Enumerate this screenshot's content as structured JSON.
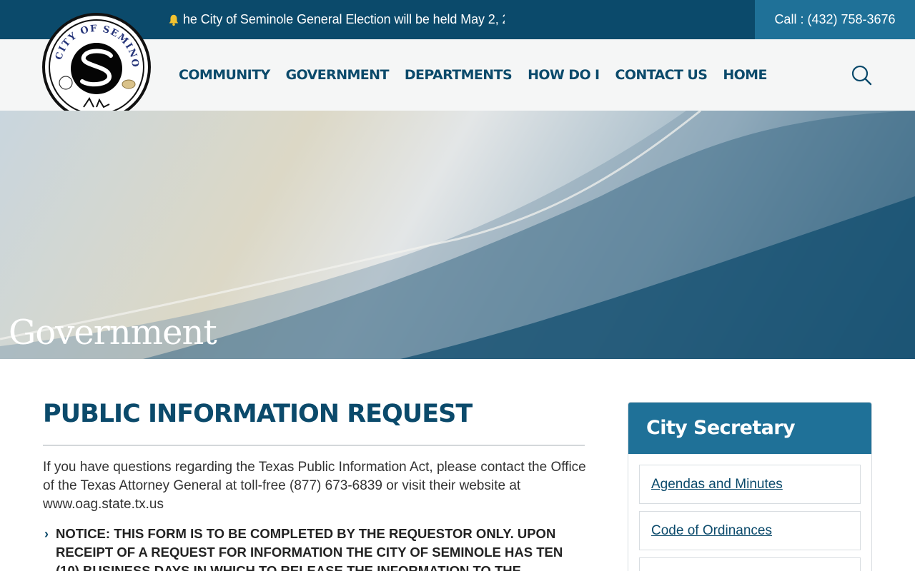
{
  "alert": {
    "icon": "bell-icon",
    "text": "he City of Seminole General Election will be held May 2, 2"
  },
  "header": {
    "call_label": "Call : (432) 758-3676",
    "logo_text": "CITY OF SEMINOLE"
  },
  "nav": {
    "items": [
      "COMMUNITY",
      "GOVERNMENT",
      "DEPARTMENTS",
      "HOW DO I",
      "CONTACT US",
      "HOME"
    ]
  },
  "hero": {
    "title": "Government"
  },
  "main": {
    "title": "PUBLIC INFORMATION REQUEST",
    "intro": "If you have questions regarding the Texas Public Information Act, please contact the Office of the Texas Attorney General at toll-free (877) 673-6839 or visit their website at www.oag.state.tx.us",
    "notice": "NOTICE: THIS FORM IS TO BE COMPLETED BY THE REQUESTOR ONLY. UPON RECEIPT OF A REQUEST FOR INFORMATION THE CITY OF SEMINOLE HAS TEN (10) BUSINESS DAYS IN WHICH TO RELEASE THE INFORMATION TO THE"
  },
  "sidebar": {
    "title": "City Secretary",
    "items": [
      "Agendas and Minutes",
      "Code of Ordinances"
    ]
  },
  "colors": {
    "primary": "#0b4a6b",
    "accent": "#1f7198",
    "alert_icon": "#f2c230"
  }
}
